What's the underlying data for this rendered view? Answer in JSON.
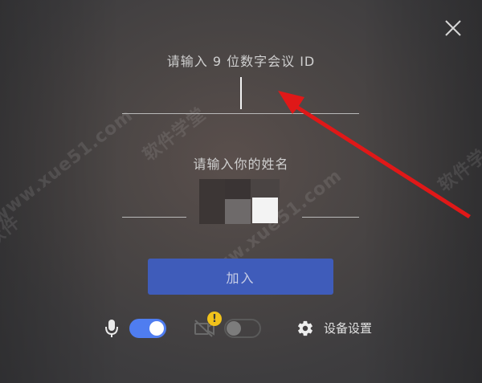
{
  "dialog": {
    "meeting_id_label": "请输入 9 位数字会议 ID",
    "meeting_id_value": "",
    "name_label": "请输入你的姓名",
    "name_value": "",
    "join_label": "加入",
    "settings_label": "设备设置",
    "warning_glyph": "!"
  },
  "toggles": {
    "microphone_on": true,
    "camera_on": false
  },
  "colors": {
    "accent": "#4f7df0",
    "join_button": "#3f5cba",
    "warning": "#f1c21b",
    "annotation_arrow": "#e01818"
  },
  "icons": {
    "close": "close-icon",
    "microphone": "microphone-icon",
    "camera": "camera-off-icon",
    "settings": "gear-icon",
    "warning": "warning-icon"
  },
  "watermarks": [
    "软件学堂",
    "www.xue51.com",
    "软件学",
    "www.xue51.com",
    "软件"
  ]
}
